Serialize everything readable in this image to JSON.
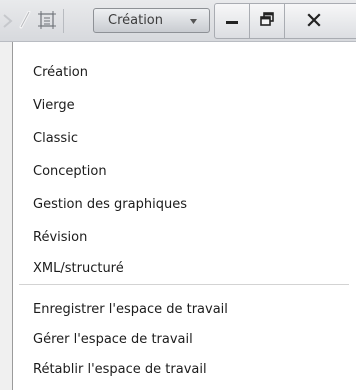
{
  "toolbar": {
    "workspace_label": "Création",
    "icons": [
      "arrow-icon",
      "pencil-icon",
      "frame-icon",
      "chevron-down-icon",
      "minimize-icon",
      "restore-icon",
      "close-icon"
    ]
  },
  "menu": {
    "workspaces": [
      {
        "label": "Création"
      },
      {
        "label": "Vierge"
      },
      {
        "label": "Classic"
      },
      {
        "label": "Conception"
      },
      {
        "label": "Gestion des graphiques"
      },
      {
        "label": "Révision"
      },
      {
        "label": "XML/structuré"
      }
    ],
    "actions": [
      {
        "label": "Enregistrer l'espace de travail"
      },
      {
        "label": "Gérer l'espace de travail"
      },
      {
        "label": "Rétablir l'espace de travail"
      }
    ]
  }
}
